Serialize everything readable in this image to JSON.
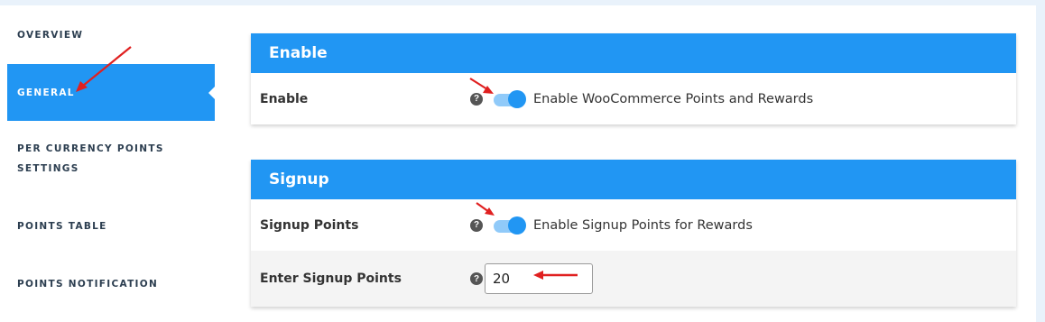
{
  "sidebar": {
    "items": [
      {
        "label": "Overview"
      },
      {
        "label": "General"
      },
      {
        "label": "Per Currency Points Settings"
      },
      {
        "label": "Points Table"
      },
      {
        "label": "Points Notification"
      }
    ],
    "active_index": 1
  },
  "panels": {
    "enable": {
      "title": "Enable",
      "rows": [
        {
          "label": "Enable",
          "help": "?",
          "toggle_on": true,
          "toggle_label": "Enable WooCommerce Points and Rewards"
        }
      ]
    },
    "signup": {
      "title": "Signup",
      "rows": [
        {
          "label": "Signup Points",
          "help": "?",
          "toggle_on": true,
          "toggle_label": "Enable Signup Points for Rewards"
        },
        {
          "label": "Enter Signup Points",
          "help": "?",
          "value": "20"
        }
      ]
    }
  },
  "colors": {
    "accent": "#2196f3",
    "toggle_track": "#90caf9",
    "annotation_arrow": "#e02020",
    "page_bg": "#e9f2fb"
  },
  "icons": {
    "help": "question-circle-icon",
    "annotation": "red-arrow-icon"
  }
}
